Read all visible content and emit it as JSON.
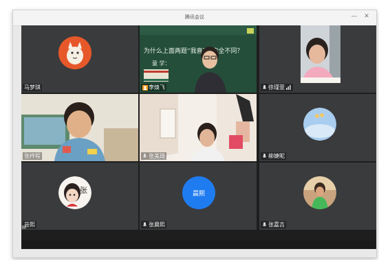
{
  "window": {
    "title": "腾讯会议",
    "minimize": "—",
    "close": "✕"
  },
  "participants": [
    {
      "name": "马梦琪",
      "avatar": "cartoon-cat-avatar"
    },
    {
      "name": "李焕飞",
      "video": "teacher-blackboard-video",
      "badge": "host-icon"
    },
    {
      "name": "徐瑾萱",
      "video": "girl-video",
      "signal": "signal-bars-icon"
    },
    {
      "name": "张梓程",
      "video": "boy-video"
    },
    {
      "name": "张美琦",
      "video": "girl-room-video"
    },
    {
      "name": "柳婕昵",
      "avatar": "sky-photo-avatar"
    },
    {
      "name": "芸熙",
      "avatar": "cartoon-girl-avatar"
    },
    {
      "name": "张晨熙",
      "avatar_text": "晨熙",
      "avatar_color": "#1f7cf0"
    },
    {
      "name": "张嘉吉",
      "avatar": "child-photo-avatar"
    }
  ],
  "blackboard_text": "为什么上面两题“我喜欢”完全不同？"
}
